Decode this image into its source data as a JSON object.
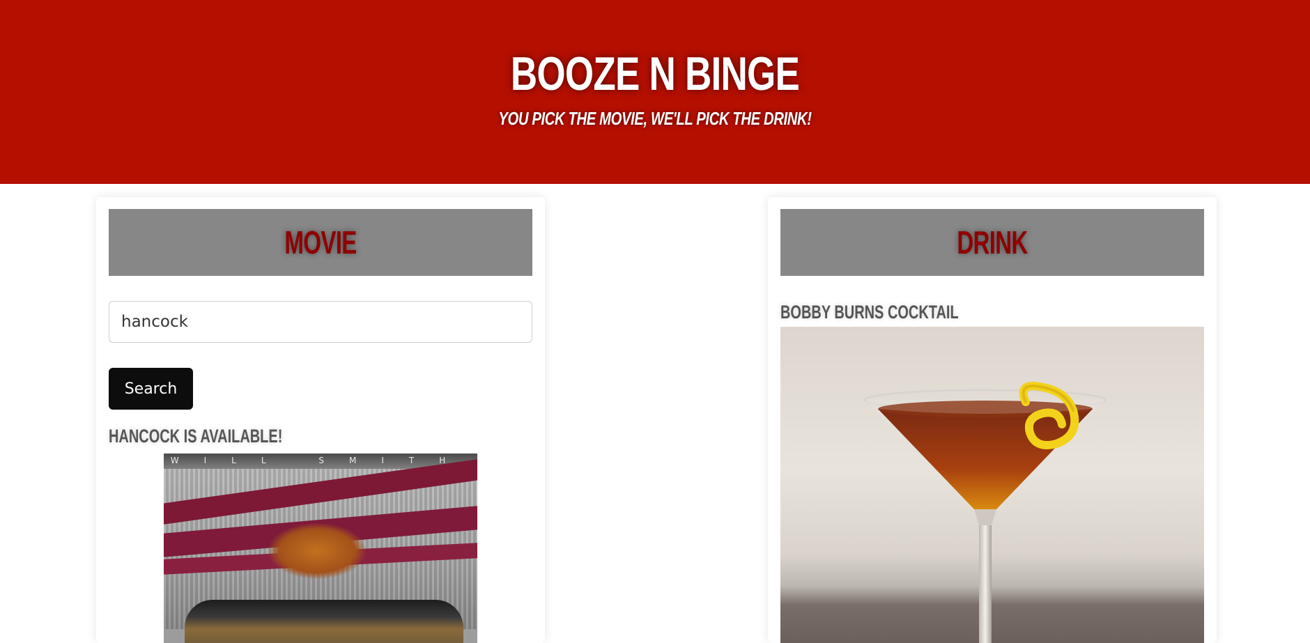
{
  "header": {
    "title": "Booze N Binge",
    "tagline": "You pick the movie, we'll pick the drink!",
    "background": "#b50f00"
  },
  "movie": {
    "heading": "Movie",
    "search_value": "hancock",
    "search_button": "Search",
    "result_text": "Hancock is available!",
    "poster_credit": "WILL SMITH"
  },
  "drink": {
    "heading": "Drink",
    "name": "Bobby Burns Cocktail"
  },
  "colors": {
    "accent": "#b50f00",
    "card_header": "#878787",
    "heading_text": "#8f0000",
    "button": "#0d0d0d"
  }
}
